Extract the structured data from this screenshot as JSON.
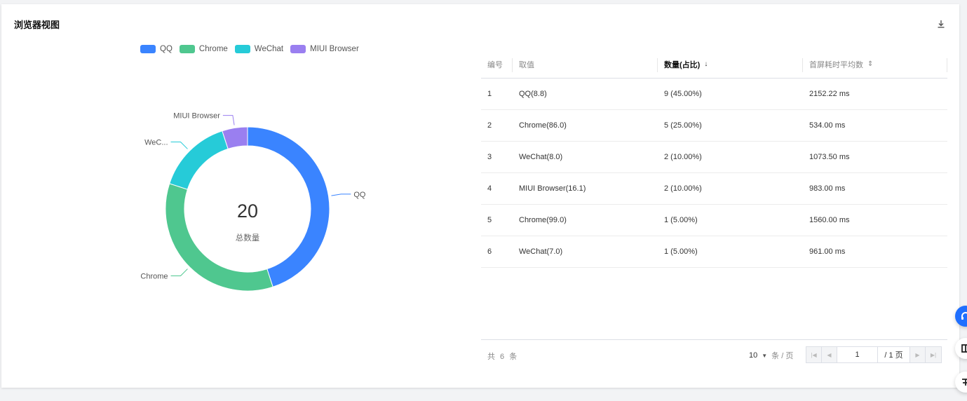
{
  "panel": {
    "title": "浏览器视图"
  },
  "icons": {
    "download": "download-icon",
    "headset": "headset-icon",
    "float2": "panel-icon",
    "float3": "expand-icon"
  },
  "colors": {
    "QQ": "#3a84ff",
    "Chrome": "#4fc78f",
    "WeChat": "#26cbd8",
    "MIUI Browser": "#9a7ff0"
  },
  "chart_data": {
    "type": "pie",
    "variant": "donut",
    "categories": [
      "QQ",
      "Chrome",
      "WeChat",
      "MIUI Browser"
    ],
    "values": [
      9,
      7,
      3,
      1
    ],
    "slice_labels": [
      "QQ",
      "Chrome",
      "WeC...",
      "MIUI Browser"
    ],
    "legend": [
      "QQ",
      "Chrome",
      "WeChat",
      "MIUI Browser"
    ],
    "legend_position": "top-center",
    "center_value": "20",
    "center_label": "总数量"
  },
  "table": {
    "headers": [
      "编号",
      "取值",
      "数量(占比)",
      "首屏耗时平均数"
    ],
    "sort_icons": {
      "count": "↓",
      "avg": "⇕"
    },
    "rows": [
      [
        "1",
        "QQ(8.8)",
        "9 (45.00%)",
        "2152.22 ms"
      ],
      [
        "2",
        "Chrome(86.0)",
        "5 (25.00%)",
        "534.00 ms"
      ],
      [
        "3",
        "WeChat(8.0)",
        "2 (10.00%)",
        "1073.50 ms"
      ],
      [
        "4",
        "MIUI Browser(16.1)",
        "2 (10.00%)",
        "983.00 ms"
      ],
      [
        "5",
        "Chrome(99.0)",
        "1 (5.00%)",
        "1560.00 ms"
      ],
      [
        "6",
        "WeChat(7.0)",
        "1 (5.00%)",
        "961.00 ms"
      ]
    ]
  },
  "pagination": {
    "total_text": "共 6 条",
    "page_size": "10",
    "page_size_unit": "条 / 页",
    "current_page": "1",
    "total_pages": "/ 1 页"
  }
}
